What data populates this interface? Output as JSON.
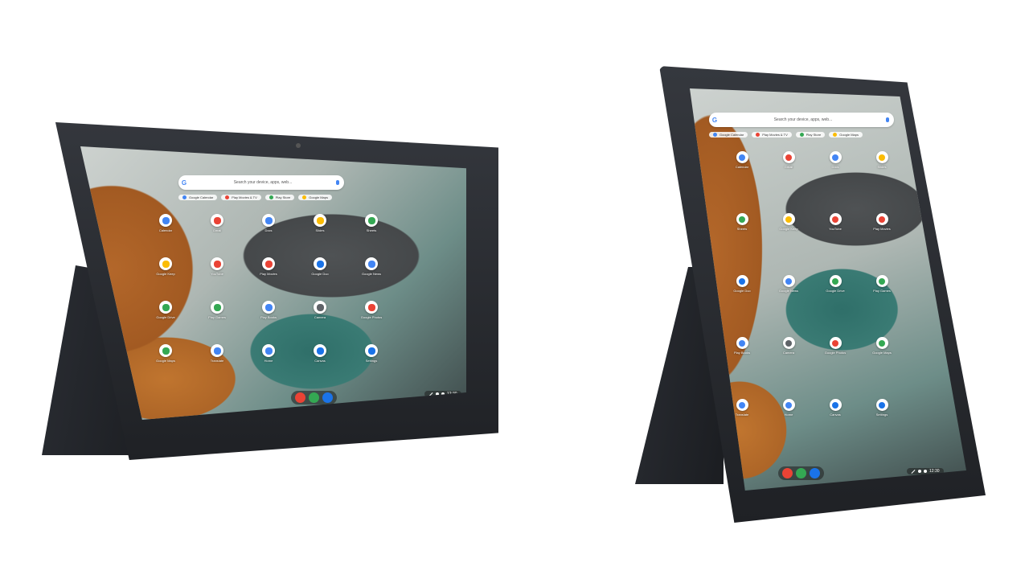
{
  "search": {
    "placeholder": "Search your device, apps, web..."
  },
  "chips": [
    {
      "label": "Google Calendar",
      "color": "#4285f4"
    },
    {
      "label": "Play Movies & TV",
      "color": "#ea4335"
    },
    {
      "label": "Play Store",
      "color": "#34a853"
    },
    {
      "label": "Google Maps",
      "color": "#fbbc04"
    }
  ],
  "apps_landscape": [
    {
      "label": "Calendar",
      "color": "#4285f4",
      "icon": "calendar-icon"
    },
    {
      "label": "Gmail",
      "color": "#ea4335",
      "icon": "gmail-icon"
    },
    {
      "label": "Docs",
      "color": "#4285f4",
      "icon": "docs-icon"
    },
    {
      "label": "Slides",
      "color": "#fbbc04",
      "icon": "slides-icon"
    },
    {
      "label": "Sheets",
      "color": "#34a853",
      "icon": "sheets-icon"
    },
    {
      "label": "Google Keep",
      "color": "#fbbc04",
      "icon": "keep-icon"
    },
    {
      "label": "YouTube",
      "color": "#ea4335",
      "icon": "youtube-icon"
    },
    {
      "label": "Play Movies",
      "color": "#ea4335",
      "icon": "play-movies-icon"
    },
    {
      "label": "Google Duo",
      "color": "#1a73e8",
      "icon": "duo-icon"
    },
    {
      "label": "Google News",
      "color": "#4285f4",
      "icon": "news-icon"
    },
    {
      "label": "Google Drive",
      "color": "#34a853",
      "icon": "drive-icon"
    },
    {
      "label": "Play Games",
      "color": "#34a853",
      "icon": "play-games-icon"
    },
    {
      "label": "Play Books",
      "color": "#4285f4",
      "icon": "play-books-icon"
    },
    {
      "label": "Camera",
      "color": "#5f6368",
      "icon": "camera-icon"
    },
    {
      "label": "Google Photos",
      "color": "#ea4335",
      "icon": "photos-icon"
    },
    {
      "label": "Google Maps",
      "color": "#34a853",
      "icon": "maps-icon"
    },
    {
      "label": "Translate",
      "color": "#4285f4",
      "icon": "translate-icon"
    },
    {
      "label": "Home",
      "color": "#4285f4",
      "icon": "home-icon"
    },
    {
      "label": "Canvas",
      "color": "#1a73e8",
      "icon": "canvas-icon"
    },
    {
      "label": "Settings",
      "color": "#1a73e8",
      "icon": "settings-icon"
    }
  ],
  "apps_portrait": [
    {
      "label": "Calendar",
      "color": "#4285f4",
      "icon": "calendar-icon"
    },
    {
      "label": "Gmail",
      "color": "#ea4335",
      "icon": "gmail-icon"
    },
    {
      "label": "Docs",
      "color": "#4285f4",
      "icon": "docs-icon"
    },
    {
      "label": "Slides",
      "color": "#fbbc04",
      "icon": "slides-icon"
    },
    {
      "label": "Sheets",
      "color": "#34a853",
      "icon": "sheets-icon"
    },
    {
      "label": "Google Keep",
      "color": "#fbbc04",
      "icon": "keep-icon"
    },
    {
      "label": "YouTube",
      "color": "#ea4335",
      "icon": "youtube-icon"
    },
    {
      "label": "Play Movies",
      "color": "#ea4335",
      "icon": "play-movies-icon"
    },
    {
      "label": "Google Duo",
      "color": "#1a73e8",
      "icon": "duo-icon"
    },
    {
      "label": "Google News",
      "color": "#4285f4",
      "icon": "news-icon"
    },
    {
      "label": "Google Drive",
      "color": "#34a853",
      "icon": "drive-icon"
    },
    {
      "label": "Play Games",
      "color": "#34a853",
      "icon": "play-games-icon"
    },
    {
      "label": "Play Books",
      "color": "#4285f4",
      "icon": "play-books-icon"
    },
    {
      "label": "Camera",
      "color": "#5f6368",
      "icon": "camera-icon"
    },
    {
      "label": "Google Photos",
      "color": "#ea4335",
      "icon": "photos-icon"
    },
    {
      "label": "Google Maps",
      "color": "#34a853",
      "icon": "maps-icon"
    },
    {
      "label": "Translate",
      "color": "#4285f4",
      "icon": "translate-icon"
    },
    {
      "label": "Home",
      "color": "#4285f4",
      "icon": "home-icon"
    },
    {
      "label": "Canvas",
      "color": "#1a73e8",
      "icon": "canvas-icon"
    },
    {
      "label": "Settings",
      "color": "#1a73e8",
      "icon": "settings-icon"
    }
  ],
  "shelf": [
    {
      "name": "chrome-icon",
      "color": "#ea4335"
    },
    {
      "name": "play-store-icon",
      "color": "#34a853"
    },
    {
      "name": "files-icon",
      "color": "#1a73e8"
    }
  ],
  "tray": {
    "time": "12:30"
  },
  "colors": {
    "background": "#ffffff",
    "bezel": "#2a2d33"
  }
}
